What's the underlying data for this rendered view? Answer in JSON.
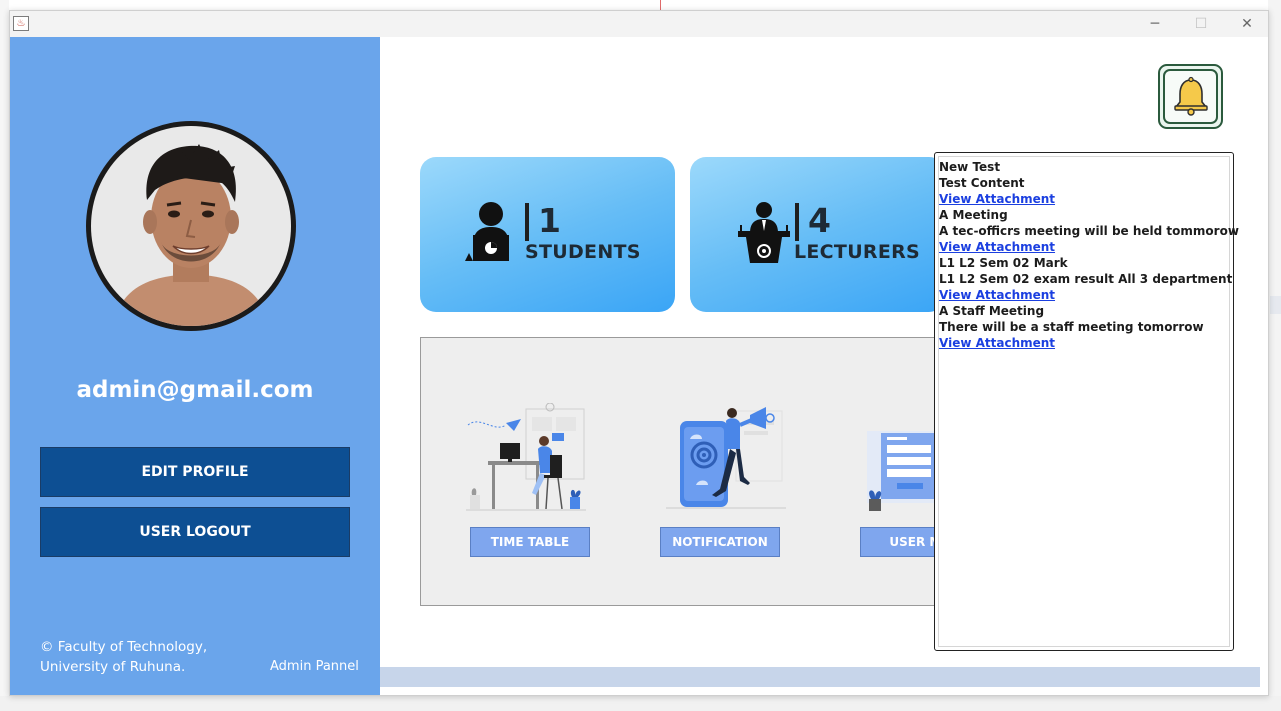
{
  "window": {
    "app_icon": "java-icon",
    "controls": {
      "minimize": "─",
      "maximize": "☐",
      "close": "✕"
    }
  },
  "sidebar": {
    "avatar_icon": "user-avatar",
    "email": "admin@gmail.com",
    "buttons": {
      "edit_profile": "EDIT PROFILE",
      "logout": "USER LOGOUT"
    },
    "footer": {
      "line1": "© Faculty of Technology,",
      "line2": "University of Ruhuna.",
      "role": "Admin Pannel"
    }
  },
  "header": {
    "bell_icon": "bell-icon"
  },
  "stats": [
    {
      "count": "1",
      "label": "STUDENTS",
      "icon": "student-icon"
    },
    {
      "count": "4",
      "label": "LECTURERS",
      "icon": "lecturer-icon"
    }
  ],
  "menu": {
    "items": [
      {
        "label": "TIME TABLE",
        "illustration": "timetable-illustration"
      },
      {
        "label": "NOTIFICATION",
        "illustration": "notification-illustration"
      },
      {
        "label": "USER MA",
        "illustration": "user-management-illustration"
      }
    ]
  },
  "notifications": [
    {
      "title": "New Test",
      "content": "Test Content",
      "link": "View Attachment"
    },
    {
      "title": "A Meeting",
      "content": "A tec-officrs meeting will be held tommorow",
      "link": "View Attachment"
    },
    {
      "title": "L1 L2 Sem 02 Mark",
      "content": "L1 L2 Sem 02 exam result All 3 department",
      "link": "View Attachment"
    },
    {
      "title": "A Staff Meeting",
      "content": "There will be a staff meeting tomorrow",
      "link": "View Attachment"
    }
  ],
  "colors": {
    "sidebar": "#6aa5eb",
    "sidebar_button": "#0d4f93",
    "card_gradient_start": "#9cd9fb",
    "card_gradient_end": "#3aa5f6",
    "menu_button": "#7fa6ee",
    "link": "#1b3fe0"
  }
}
